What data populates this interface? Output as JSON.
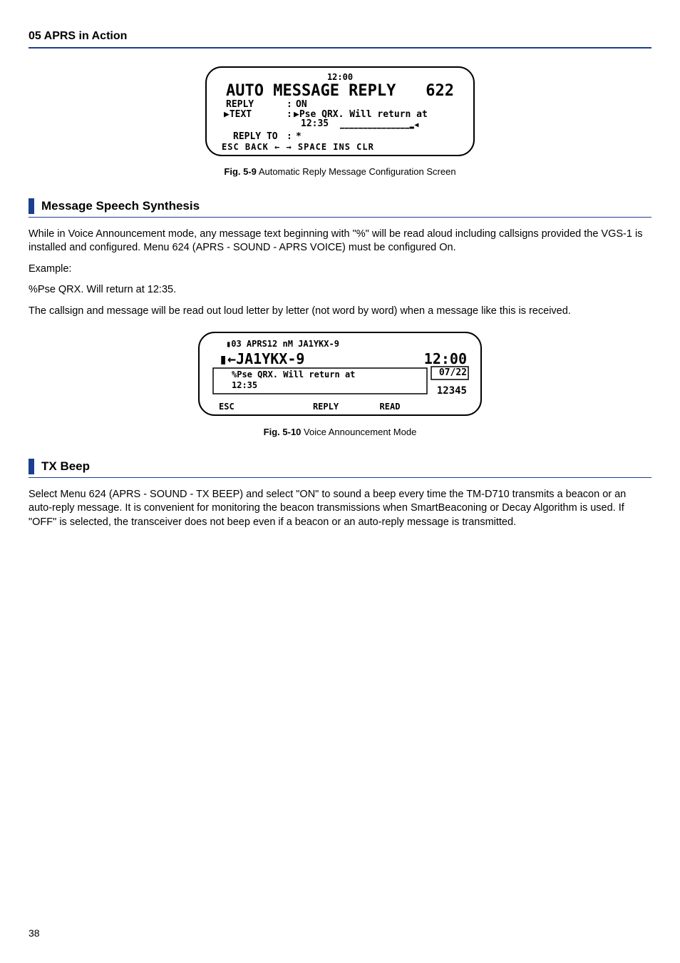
{
  "header": {
    "chapter": "05  APRS in Action"
  },
  "fig59": {
    "label": "Fig. 5-9",
    "caption_rest": " Automatic Reply Message Configuration Screen",
    "lcd": {
      "clock": "12:00",
      "title": "AUTO MESSAGE REPLY",
      "menu_no": "622",
      "row1_left": "REPLY",
      "row1_colon": ":",
      "row1_val": "ON",
      "row2_left": "▶TEXT",
      "row2_colon": ":",
      "row2_val": "▶Pse QRX. Will return at",
      "row2_val2": "12:35",
      "row2_cursor_trail": "▁▁▁▁▁▁▁▁▁▁▁▁▁▁▁▂◀",
      "row3_left": "REPLY TO",
      "row3_colon": ":",
      "row3_val": "*",
      "bottom": "ESC BACK  ←    →  SPACE INS  CLR"
    }
  },
  "section1": {
    "title": "Message Speech Synthesis",
    "para1": "While in Voice Announcement mode, any message text beginning with \"%\" will be read aloud including callsigns provided the VGS-1 is installed and configured.  Menu 624 (APRS - SOUND - APRS VOICE) must be configured On.",
    "example_label": "Example:",
    "example_msg": "%Pse QRX.  Will return at 12:35.",
    "para2": "The callsign and message will be read out loud letter by letter (not word by word) when a message like this is received."
  },
  "fig510": {
    "label": "Fig. 5-10",
    "caption_rest": " Voice Announcement Mode",
    "lcd": {
      "top": "▮03 APRS12   nM JA1YKX-9",
      "callsign": "▮←JA1YKX-9",
      "clock": "12:00",
      "msg1": "%Pse QRX. Will return at",
      "date": "07/22",
      "msg2": "12:35",
      "seq": "12345",
      "bottom_left": "ESC",
      "bottom_mid": "REPLY",
      "bottom_right": "READ"
    }
  },
  "section2": {
    "title": "TX Beep",
    "para1": "Select Menu 624 (APRS - SOUND - TX BEEP) and select \"ON\" to sound a beep every time the TM-D710 transmits a beacon or an auto-reply message.  It is convenient for monitoring the beacon transmissions when SmartBeaconing or Decay Algorithm is used.  If \"OFF\" is selected, the transceiver does not beep even if a beacon or an auto-reply message is transmitted."
  },
  "page_number": "38"
}
